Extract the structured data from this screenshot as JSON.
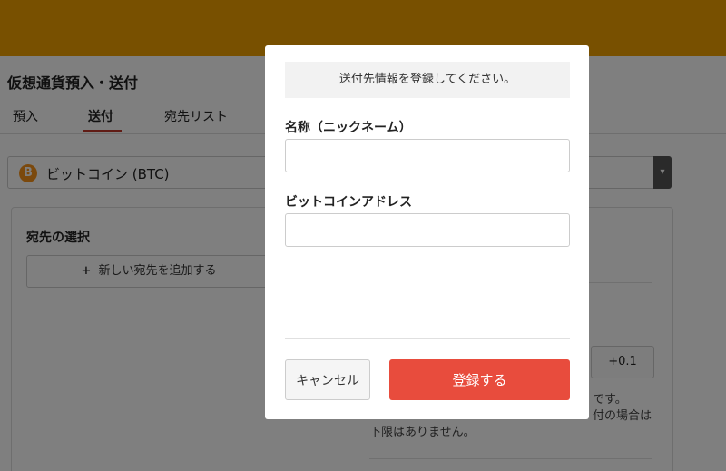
{
  "page": {
    "title": "仮想通貨預入・送付",
    "tabs": [
      {
        "label": "預入"
      },
      {
        "label": "送付"
      },
      {
        "label": "宛先リスト"
      }
    ],
    "currency": {
      "label": "ビットコイン (BTC)",
      "icon": "bitcoin-icon",
      "arrow": "▾",
      "icon_glyph": "B"
    },
    "panel": {
      "heading": "宛先の選択",
      "add_label": "新しい宛先を追加する",
      "plus_glyph": "+",
      "amount_step": "+0.1",
      "notes": [
        "です。",
        "付の場合は",
        "下限はありません。"
      ]
    }
  },
  "modal": {
    "info": "送付先情報を登録してください。",
    "nickname_label": "名称（ニックネーム）",
    "nickname_value": "",
    "address_label": "ビットコインアドレス",
    "address_value": "",
    "cancel_label": "キャンセル",
    "register_label": "登録する"
  },
  "colors": {
    "topbar": "#f0a000",
    "accent": "#e84c3d",
    "tab_underline": "#c0392b"
  }
}
